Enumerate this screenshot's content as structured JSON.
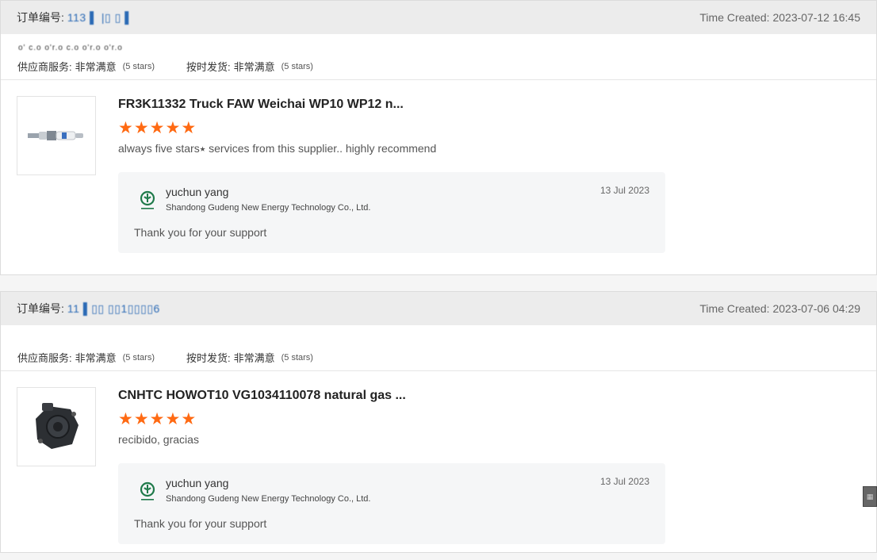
{
  "orders": [
    {
      "order_id_label": "订单编号:",
      "order_id_value": "113 ▌ |▯ ▯ ▌",
      "time_created": "Time Created: 2023-07-12 16:45",
      "masked_line": "o' c.o  o'r.o  c.o  o'r.o  o'r.o",
      "ratings": {
        "service_label": "供应商服务:",
        "service_value": "非常满意",
        "service_stars": "(5 stars)",
        "shipping_label": "按时发货:",
        "shipping_value": "非常满意",
        "shipping_stars": "(5 stars)"
      },
      "product": {
        "title": "FR3K11332 Truck FAW Weichai WP10 WP12 n...",
        "thumbnail": "spark-plug-image",
        "rating": 5,
        "review": "always five stars⭑ services from this supplier.. highly recommend"
      },
      "reply": {
        "logo": "gudeng-logo-icon",
        "name": "yuchun yang",
        "company": "Shandong Gudeng New Energy Technology Co., Ltd.",
        "date": "13 Jul 2023",
        "text": "Thank you for your support"
      }
    },
    {
      "order_id_label": "订单编号:",
      "order_id_value": "11 ▌▯▯ ▯▯1▯▯▯▯6",
      "time_created": "Time Created: 2023-07-06 04:29",
      "masked_line": "",
      "ratings": {
        "service_label": "供应商服务:",
        "service_value": "非常满意",
        "service_stars": "(5 stars)",
        "shipping_label": "按时发货:",
        "shipping_value": "非常满意",
        "shipping_stars": "(5 stars)"
      },
      "product": {
        "title": "CNHTC HOWOT10 VG1034110078 natural gas ...",
        "thumbnail": "gas-valve-part-image",
        "rating": 5,
        "review": "recibido, gracias"
      },
      "reply": {
        "logo": "gudeng-logo-icon",
        "name": "yuchun yang",
        "company": "Shandong Gudeng New Energy Technology Co., Ltd.",
        "date": "13 Jul 2023",
        "text": "Thank you for your support"
      }
    }
  ],
  "colors": {
    "star": "#ff6a13",
    "header_bg": "#ececec",
    "order_id_link": "#2b6ab5"
  }
}
